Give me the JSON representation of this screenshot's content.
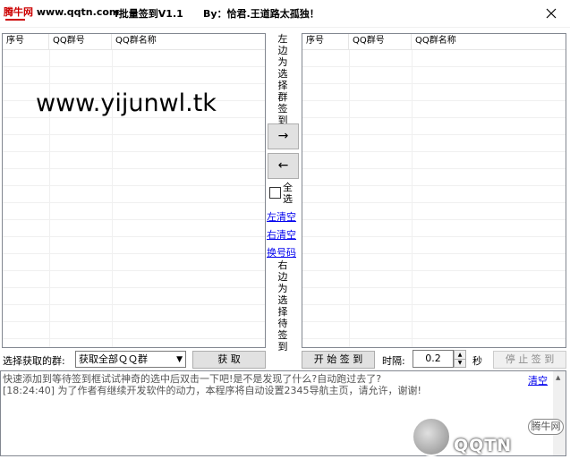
{
  "titlebar": {
    "site_prefix": "腾牛网",
    "site_url": "www.qqtn.com",
    "app_title_fragment": "f批量签到V1.1",
    "author": "By：恰君.王道路太孤独！",
    "close_glyph": "✕"
  },
  "left_list": {
    "columns": [
      "序号",
      "QQ群号",
      "QQ群名称"
    ],
    "overlay_text": "www.yijunwl.tk"
  },
  "right_list": {
    "columns": [
      "序号",
      "QQ群号",
      "QQ群名称"
    ]
  },
  "middle": {
    "left_hint": "左边为选择群签到",
    "move_right": "→",
    "move_left": "←",
    "select_all": "全选",
    "clear_left": "左清空",
    "clear_right": "右清空",
    "change_code": "换号码",
    "right_hint": "右边为选择待签到"
  },
  "bottom": {
    "select_group_label": "选择获取的群:",
    "group_select_value": "获取全部ＱＱ群",
    "fetch_button": "获 取",
    "start_button": "开 始 签 到",
    "interval_label": "时隔:",
    "interval_value": "0.2",
    "seconds_label": "秒",
    "stop_button": "停 止 签 到"
  },
  "log": {
    "lines": [
      "快速添加到等待签到框试试神奇的选中后双击一下吧!是不是发现了什么?自动跑过去了?",
      "[18:24:40] 为了作者有继续开发软件的动力，本程序将自动设置2345导航主页，请允许，谢谢!"
    ],
    "clear_link": "清空"
  },
  "watermark": {
    "brand": "QQTN",
    "badge": "腾牛网"
  },
  "colors": {
    "link": "#0000ee",
    "site_red": "#cc0000",
    "button_face": "#e1e1e1"
  }
}
